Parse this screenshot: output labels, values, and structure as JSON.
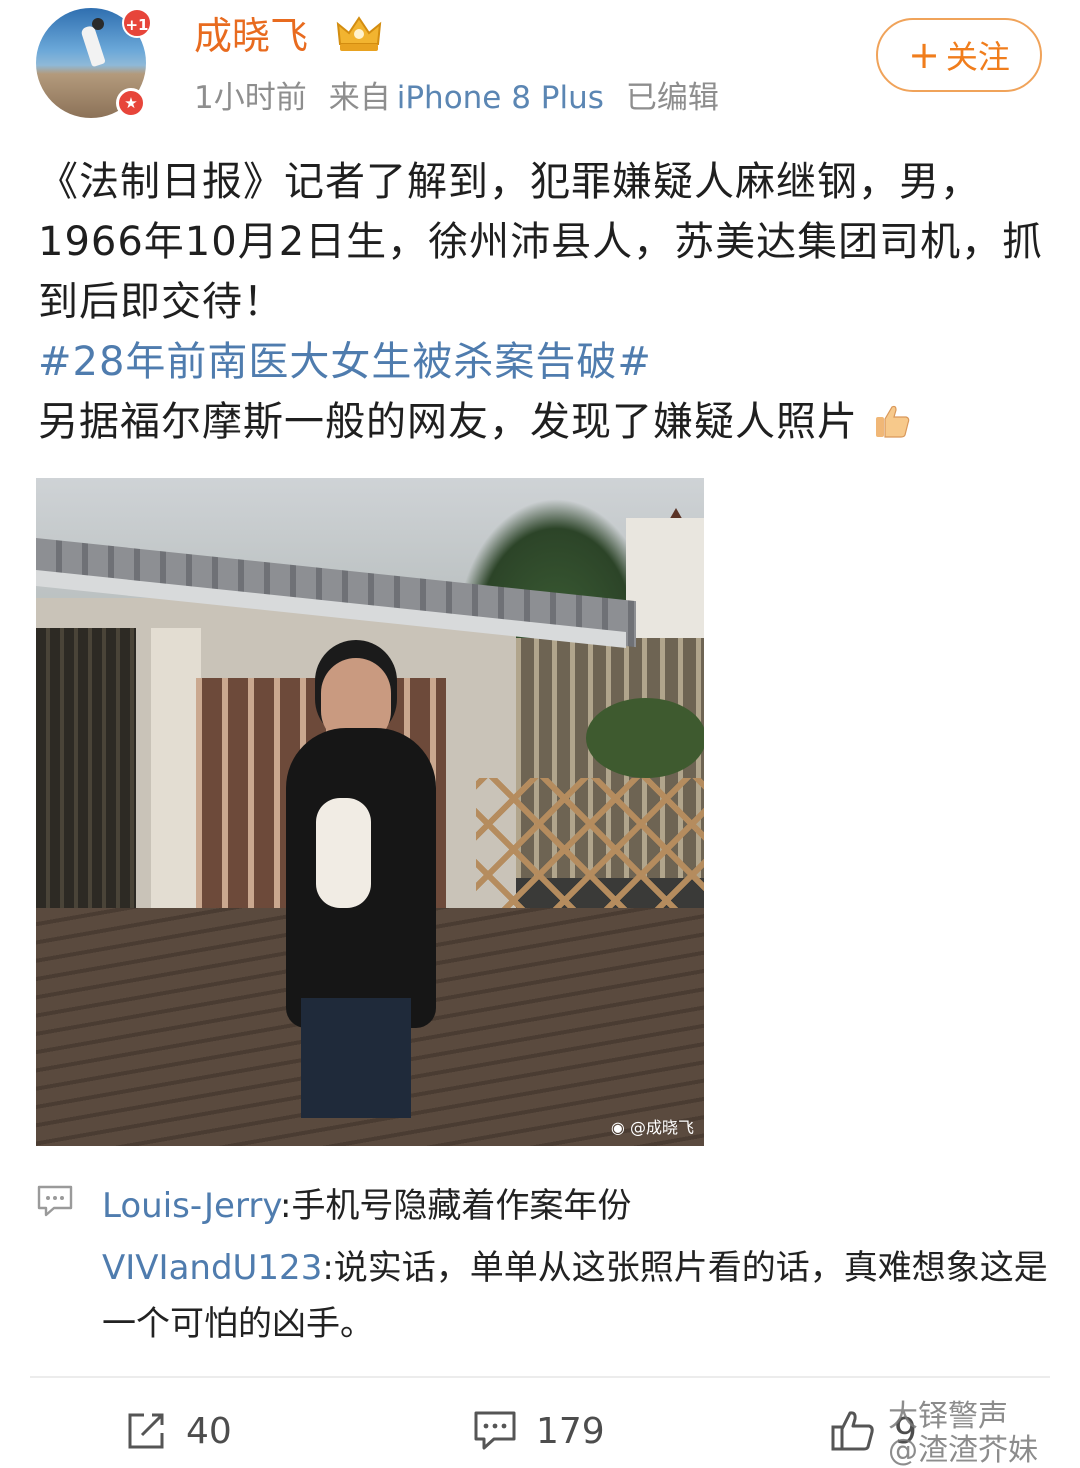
{
  "header": {
    "username": "成晓飞",
    "avatar_badge_count": "+1",
    "time": "1小时前",
    "source_prefix": "来自",
    "device": "iPhone 8 Plus",
    "edited": "已编辑",
    "follow_plus": "+",
    "follow_label": "关注",
    "crown_icon": "crown-vip-icon",
    "verified_icon": "verified-star-icon"
  },
  "post": {
    "line1": "《法制日报》记者了解到，犯罪嫌疑人麻继钢，男，1966年10月2日生，徐州沛县人，苏美达集团司机，抓到后即交待！",
    "hashtag": "#28年前南医大女生被杀案告破#",
    "line2": "另据福尔摩斯一般的网友，发现了嫌疑人照片",
    "thumbs_icon": "thumbs-up-emoji-icon"
  },
  "photo": {
    "watermark": "@成晓飞"
  },
  "comments": [
    {
      "author": "Louis-Jerry",
      "sep": ":",
      "text": "手机号隐藏着作案年份"
    },
    {
      "author": "VIVIandU123",
      "sep": ":",
      "text": "说实话，单单从这张照片看的话，真难想象这是一个可怕的凶手。"
    }
  ],
  "actions": {
    "forward_count": "40",
    "comment_count": "179",
    "like_count": "9"
  },
  "overlay_watermark": {
    "line1": "大铎警声",
    "line2": "@渣渣芥妹"
  },
  "colors": {
    "username": "#e86b1f",
    "link": "#4f7cae",
    "follow_border": "#f0a35a",
    "badge": "#e7453a"
  }
}
